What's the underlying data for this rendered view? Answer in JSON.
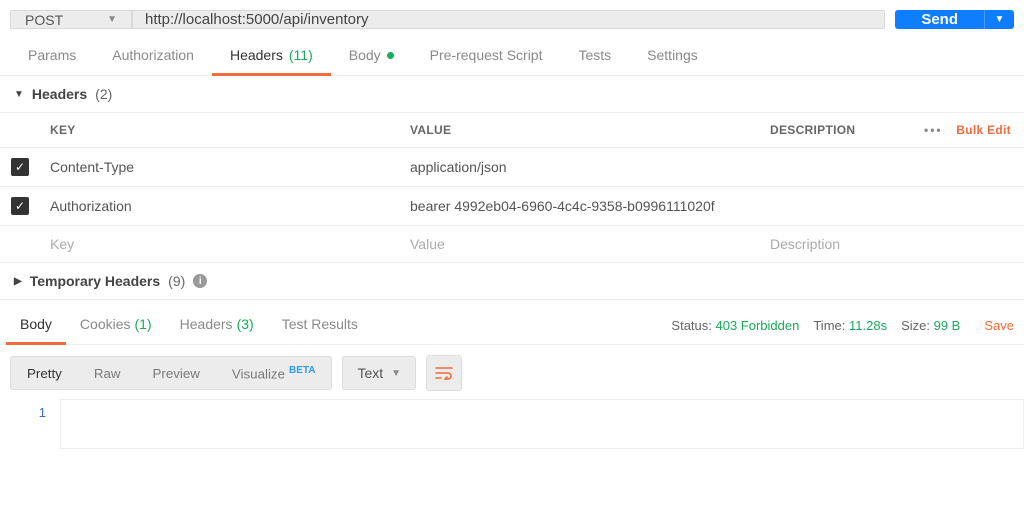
{
  "request": {
    "method": "POST",
    "url": "http://localhost:5000/api/inventory",
    "send_label": "Send"
  },
  "req_tabs": {
    "params": "Params",
    "auth": "Authorization",
    "headers": "Headers",
    "headers_count": "(11)",
    "body": "Body",
    "prerequest": "Pre-request Script",
    "tests": "Tests",
    "settings": "Settings"
  },
  "headers_section": {
    "title": "Headers",
    "count": "(2)",
    "col_key": "KEY",
    "col_value": "VALUE",
    "col_desc": "DESCRIPTION",
    "bulk_edit": "Bulk Edit",
    "rows": [
      {
        "key": "Content-Type",
        "value": "application/json"
      },
      {
        "key": "Authorization",
        "value": "bearer 4992eb04-6960-4c4c-9358-b0996111020f"
      }
    ],
    "placeholder": {
      "key": "Key",
      "value": "Value",
      "desc": "Description"
    }
  },
  "temp_headers": {
    "title": "Temporary Headers",
    "count": "(9)"
  },
  "resp_tabs": {
    "body": "Body",
    "cookies": "Cookies",
    "cookies_count": "(1)",
    "headers": "Headers",
    "headers_count": "(3)",
    "tests": "Test Results"
  },
  "resp_status": {
    "status_label": "Status:",
    "status_value": "403 Forbidden",
    "time_label": "Time:",
    "time_value": "11.28s",
    "size_label": "Size:",
    "size_value": "99 B",
    "save": "Save"
  },
  "view": {
    "pretty": "Pretty",
    "raw": "Raw",
    "preview": "Preview",
    "visualize": "Visualize",
    "beta": "BETA",
    "format": "Text"
  },
  "code": {
    "line1": "1",
    "content": ""
  }
}
